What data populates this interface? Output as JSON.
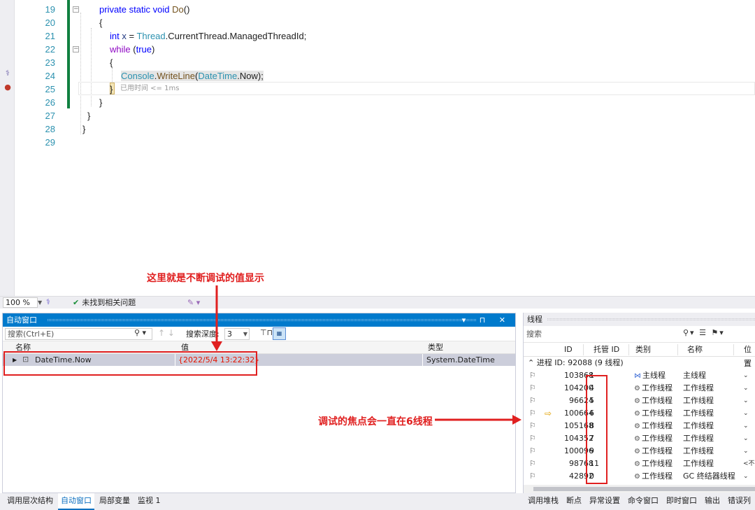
{
  "editor": {
    "lines": [
      {
        "n": "19",
        "tokens": [
          [
            "kw",
            "private"
          ],
          [
            "tx",
            " "
          ],
          [
            "kw",
            "static"
          ],
          [
            "tx",
            " "
          ],
          [
            "kw",
            "void"
          ],
          [
            "tx",
            " "
          ],
          [
            "mt",
            "Do"
          ],
          [
            "tx",
            "()"
          ]
        ]
      },
      {
        "n": "20",
        "tokens": [
          [
            "tx",
            "{"
          ]
        ]
      },
      {
        "n": "21",
        "tokens": [
          [
            "kw",
            "int"
          ],
          [
            "tx",
            " "
          ],
          [
            "var",
            "x"
          ],
          [
            "tx",
            " = "
          ],
          [
            "ty",
            "Thread"
          ],
          [
            "tx",
            "."
          ],
          [
            "tx",
            "CurrentThread"
          ],
          [
            "tx",
            "."
          ],
          [
            "tx",
            "ManagedThreadId"
          ],
          [
            "tx",
            ";"
          ]
        ]
      },
      {
        "n": "22",
        "tokens": [
          [
            "kw2",
            "while"
          ],
          [
            "tx",
            " ("
          ],
          [
            "kw",
            "true"
          ],
          [
            "tx",
            ")"
          ]
        ]
      },
      {
        "n": "23",
        "tokens": [
          [
            "tx",
            "{"
          ]
        ]
      },
      {
        "n": "24",
        "tokens": [
          [
            "ty",
            "Console"
          ],
          [
            "tx",
            "."
          ],
          [
            "mt",
            "WriteLine"
          ],
          [
            "tx",
            "("
          ],
          [
            "ty",
            "DateTime"
          ],
          [
            "tx",
            "."
          ],
          [
            "tx",
            "Now"
          ],
          [
            "tx",
            ");"
          ]
        ]
      },
      {
        "n": "25",
        "tokens": [
          [
            "tx",
            "}"
          ]
        ]
      },
      {
        "n": "26",
        "tokens": [
          [
            "tx",
            "}"
          ]
        ]
      },
      {
        "n": "27",
        "tokens": [
          [
            "tx",
            "}"
          ]
        ]
      },
      {
        "n": "28",
        "tokens": [
          [
            "tx",
            "}"
          ]
        ]
      },
      {
        "n": "29",
        "tokens": []
      }
    ],
    "perf_tip": "已用时间 <= 1ms"
  },
  "annotations": {
    "value_display": "这里就是不断调试的值显示",
    "focus_thread": "调试的焦点会一直在6线程"
  },
  "status": {
    "zoom": "100 %",
    "issues": "未找到相关问题"
  },
  "autos": {
    "title": "自动窗口",
    "search_placeholder": "搜索(Ctrl+E)",
    "depth_label": "搜索深度:",
    "depth_value": "3",
    "columns": {
      "name": "名称",
      "value": "值",
      "type": "类型"
    },
    "row": {
      "name": "DateTime.Now",
      "value": "{2022/5/4 13:22:32}",
      "type": "System.DateTime"
    }
  },
  "threads": {
    "title": "线程",
    "search_placeholder": "搜索",
    "columns": {
      "id": "ID",
      "managed_id": "托管 ID",
      "category": "类别",
      "name": "名称",
      "location": "位置"
    },
    "process": "进程 ID: 92088  (9 线程)",
    "rows": [
      {
        "id": "103868",
        "managed": "1",
        "category": "主线程",
        "name": "主线程",
        "current": false,
        "main": true,
        "loc": "⌄"
      },
      {
        "id": "104200",
        "managed": "4",
        "category": "工作线程",
        "name": "工作线程",
        "current": false,
        "main": false,
        "loc": "⌄"
      },
      {
        "id": "96624",
        "managed": "5",
        "category": "工作线程",
        "name": "工作线程",
        "current": false,
        "main": false,
        "loc": "⌄"
      },
      {
        "id": "100664",
        "managed": "6",
        "category": "工作线程",
        "name": "工作线程",
        "current": true,
        "main": false,
        "loc": "⌄"
      },
      {
        "id": "105168",
        "managed": "8",
        "category": "工作线程",
        "name": "工作线程",
        "current": false,
        "main": false,
        "loc": "⌄"
      },
      {
        "id": "104352",
        "managed": "7",
        "category": "工作线程",
        "name": "工作线程",
        "current": false,
        "main": false,
        "loc": "⌄"
      },
      {
        "id": "100096",
        "managed": "9",
        "category": "工作线程",
        "name": "工作线程",
        "current": false,
        "main": false,
        "loc": "⌄"
      },
      {
        "id": "98768",
        "managed": "11",
        "category": "工作线程",
        "name": "工作线程",
        "current": false,
        "main": false,
        "loc": "<不"
      },
      {
        "id": "42892",
        "managed": "0",
        "category": "工作线程",
        "name": "GC 终结器线程",
        "current": false,
        "main": false,
        "loc": "⌄"
      }
    ]
  },
  "bottom_tabs_left": [
    {
      "label": "调用层次结构",
      "active": false
    },
    {
      "label": "自动窗口",
      "active": true
    },
    {
      "label": "局部变量",
      "active": false
    },
    {
      "label": "监视 1",
      "active": false
    }
  ],
  "bottom_tabs_right": [
    "调用堆栈",
    "断点",
    "异常设置",
    "命令窗口",
    "即时窗口",
    "输出",
    "错误列"
  ],
  "colors": {
    "accent": "#007acc",
    "annotation": "#e02020",
    "value_changed": "#e51400",
    "change_bar": "#108040"
  }
}
